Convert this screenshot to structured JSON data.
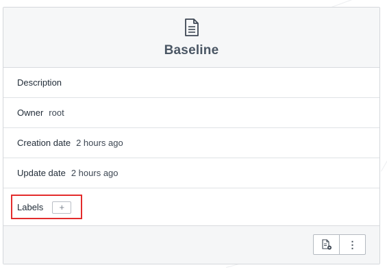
{
  "card": {
    "title": "Baseline",
    "header_icon": "document-icon"
  },
  "fields": {
    "description_label": "Description",
    "owner_label": "Owner",
    "owner_value": "root",
    "creation_label": "Creation date",
    "creation_value": "2 hours ago",
    "update_label": "Update date",
    "update_value": "2 hours ago",
    "labels_label": "Labels",
    "add_label_symbol": "+"
  },
  "footer": {
    "actions": [
      {
        "icon": "export-document-icon"
      },
      {
        "icon": "kebab-menu-icon",
        "symbol": "⋮"
      }
    ]
  },
  "colors": {
    "highlight": "#e32b2b",
    "title": "#4a5664"
  }
}
